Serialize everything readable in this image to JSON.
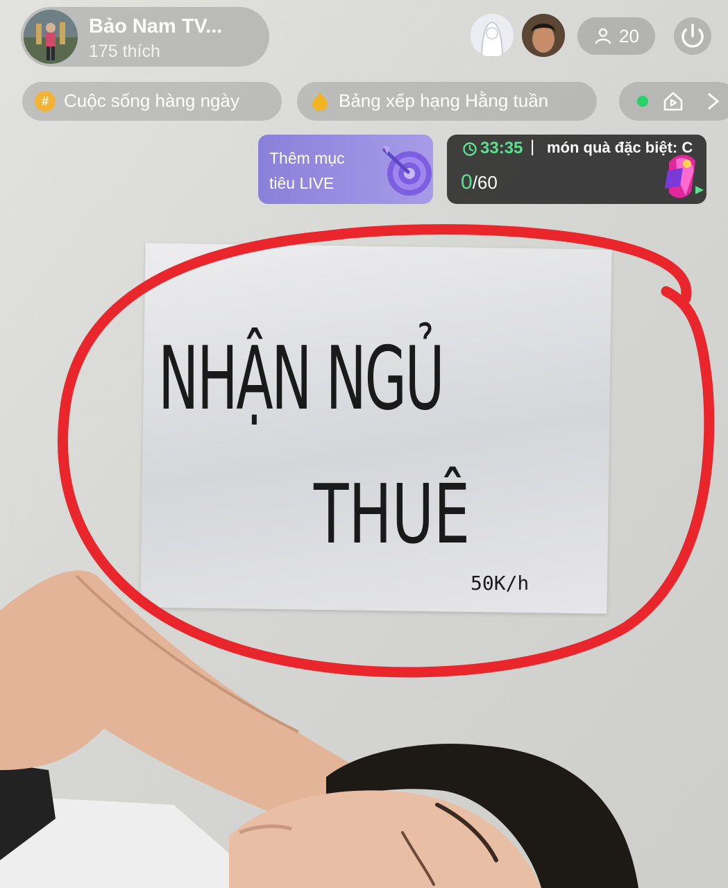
{
  "header": {
    "streamer_name": "Bảo Nam TV...",
    "likes": "175 thích",
    "viewer_count": "20"
  },
  "tags": {
    "category": "Cuộc sống hàng ngày",
    "ranking": "Bảng xếp hạng Hằng tuần"
  },
  "goal": {
    "label": "Thêm mục tiêu LIVE"
  },
  "gift": {
    "timer": "33:35",
    "separator": "|",
    "title": "món quà đặc biệt: C",
    "current": "0",
    "total": "/60"
  },
  "sign": {
    "line1": "NHẬN NGỦ",
    "line2": "THUÊ",
    "price": "50K/h"
  },
  "colors": {
    "circle": "#e8262c",
    "timer_green": "#5ce08e",
    "goal_purple": "#9a8fe0"
  },
  "icons": {
    "viewer": "person-icon",
    "power": "power-icon",
    "category": "hash-icon",
    "ranking": "flame-icon",
    "live_dot": "green-dot-icon",
    "home": "house-icon",
    "more": "chevron-right-icon",
    "goal": "target-icon",
    "timer": "clock-icon",
    "gift": "gift-icon"
  }
}
